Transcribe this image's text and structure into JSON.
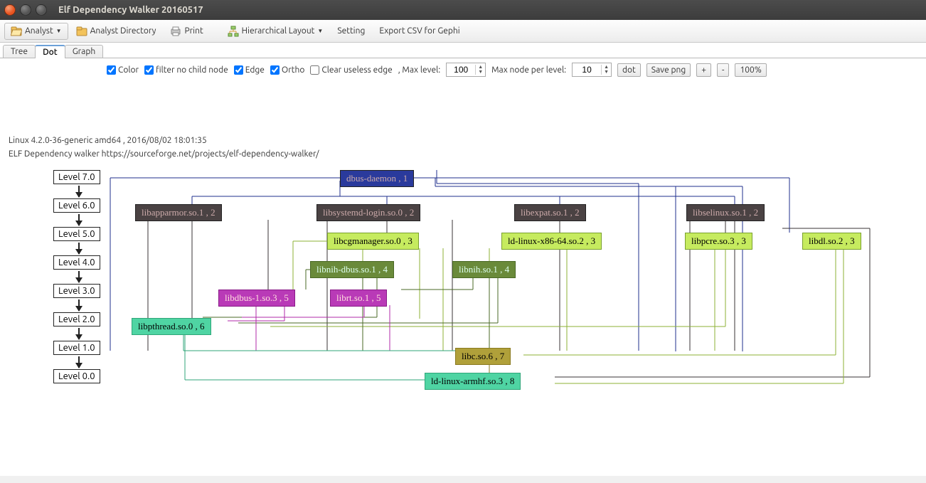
{
  "window": {
    "title": "Elf Dependency Walker 20160517"
  },
  "toolbar": {
    "analyst": "Analyst",
    "analyst_dir": "Analyst Directory",
    "print": "Print",
    "layout": "Hierarchical Layout",
    "setting": "Setting",
    "export_csv": "Export CSV for Gephi"
  },
  "tabs": {
    "tree": "Tree",
    "dot": "Dot",
    "graph": "Graph",
    "active": "Dot"
  },
  "controls": {
    "color": "Color",
    "filter": "filter no child node",
    "edge": "Edge",
    "ortho": "Ortho",
    "clear_useless": "Clear useless edge",
    "max_level_label": ", Max level:",
    "max_level": "100",
    "max_node_label": "Max node per level:",
    "max_node": "10",
    "dot": "dot",
    "save_png": "Save png",
    "plus": "+",
    "minus": "-",
    "zoom": "100%"
  },
  "info_line1": "Linux 4.2.0-36-generic amd64 , 2016/08/02 18:01:35",
  "info_line2": "ELF Dependency walker https://sourceforge.net/projects/elf-dependency-walker/",
  "levels": [
    "Level 7.0",
    "Level 6.0",
    "Level 5.0",
    "Level 4.0",
    "Level 3.0",
    "Level 2.0",
    "Level 1.0",
    "Level 0.0"
  ],
  "nodes": {
    "n0": "dbus-daemon , 1",
    "n1": "libapparmor.so.1 , 2",
    "n2": "libsystemd-login.so.0 , 2",
    "n3": "libexpat.so.1 , 2",
    "n4": "libselinux.so.1 , 2",
    "n5": "libcgmanager.so.0 , 3",
    "n6": "ld-linux-x86-64.so.2 , 3",
    "n7": "libpcre.so.3 , 3",
    "n8": "libdl.so.2 , 3",
    "n9": "libnih-dbus.so.1 , 4",
    "n10": "libnih.so.1 , 4",
    "n11": "libdbus-1.so.3 , 5",
    "n12": "librt.so.1 , 5",
    "n13": "libpthread.so.0 , 6",
    "n14": "libc.so.6 , 7",
    "n15": "ld-linux-armhf.so.3 , 8"
  },
  "colors": {
    "navy": "#2a3a9c",
    "dark": "#4a4243",
    "yellowgreen": "#c6eb5f",
    "darkgreen": "#6a8a3a",
    "olive": "#6a8a2a",
    "magenta": "#b93ab7",
    "teal": "#4fd4a3",
    "oliveyellow": "#b0a03a"
  }
}
